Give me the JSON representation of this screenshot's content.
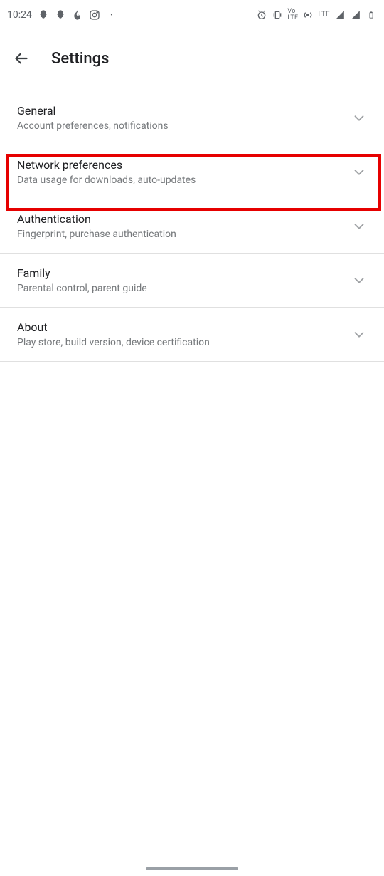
{
  "status": {
    "time": "10:24",
    "lte": "LTE"
  },
  "app": {
    "title": "Settings"
  },
  "items": [
    {
      "title": "General",
      "subtitle": "Account preferences, notifications"
    },
    {
      "title": "Network preferences",
      "subtitle": "Data usage for downloads, auto-updates"
    },
    {
      "title": "Authentication",
      "subtitle": "Fingerprint, purchase authentication"
    },
    {
      "title": "Family",
      "subtitle": "Parental control, parent guide"
    },
    {
      "title": "About",
      "subtitle": "Play store, build version, device certification"
    }
  ]
}
